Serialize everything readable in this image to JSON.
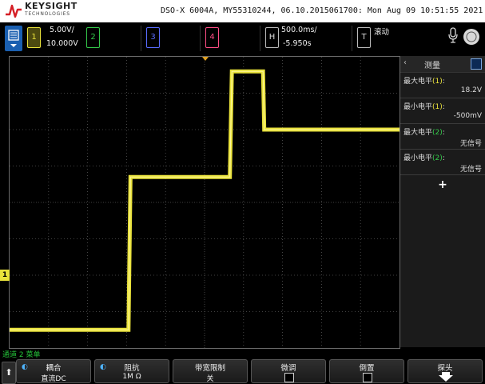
{
  "header": {
    "brand": "KEYSIGHT",
    "brand_sub": "TECHNOLOGIES",
    "device_line": "DSO-X 6004A, MY55310244, 06.10.2015061700: Mon Aug 09 10:51:55 2021"
  },
  "channels": [
    {
      "num": "1",
      "scale": "5.00V/",
      "offset": "10.000V",
      "color": "#e9e23b"
    },
    {
      "num": "2",
      "color": "#34c84a"
    },
    {
      "num": "3",
      "color": "#5a6cff"
    },
    {
      "num": "4",
      "color": "#ff4f86"
    }
  ],
  "horizontal": {
    "key": "H",
    "scale": "500.0ms/",
    "delay": "-5.950s"
  },
  "trigger": {
    "key": "T",
    "mode": "滚动"
  },
  "marker": {
    "ch1_ground": "1"
  },
  "measurements": {
    "title": "测量",
    "items": [
      {
        "label": "最大电平",
        "source": "(1)",
        "source_channel": 1,
        "value": "18.2V"
      },
      {
        "label": "最小电平",
        "source": "(1)",
        "source_channel": 1,
        "value": "-500mV"
      },
      {
        "label": "最大电平",
        "source": "(2)",
        "source_channel": 2,
        "value": "无信号"
      },
      {
        "label": "最小电平",
        "source": "(2)",
        "source_channel": 2,
        "value": "无信号"
      }
    ],
    "add_label": "+"
  },
  "menu_title": "通道 2 菜单",
  "softkeys": [
    {
      "label": "耦合",
      "value": "直流DC",
      "type": "value",
      "knob": true
    },
    {
      "label": "阻抗",
      "value": "1M Ω",
      "type": "value",
      "knob": true
    },
    {
      "label": "带宽限制",
      "value": "关",
      "type": "value"
    },
    {
      "label": "微调",
      "type": "check"
    },
    {
      "label": "倒置",
      "type": "check"
    },
    {
      "label": "探头",
      "type": "arrow"
    }
  ],
  "colors": {
    "trace": "#e9e23b",
    "grid": "#555555",
    "menu": "#25c53a"
  },
  "waveform": {
    "steps": [
      {
        "t_from": 0.0,
        "t_to": 0.305,
        "level": 0.5
      },
      {
        "t_from": 0.31,
        "t_to": 0.565,
        "level": 4.7
      },
      {
        "t_from": 0.57,
        "t_to": 0.65,
        "level": 7.6
      },
      {
        "t_from": 0.653,
        "t_to": 1.0,
        "level": 6.0
      }
    ]
  }
}
